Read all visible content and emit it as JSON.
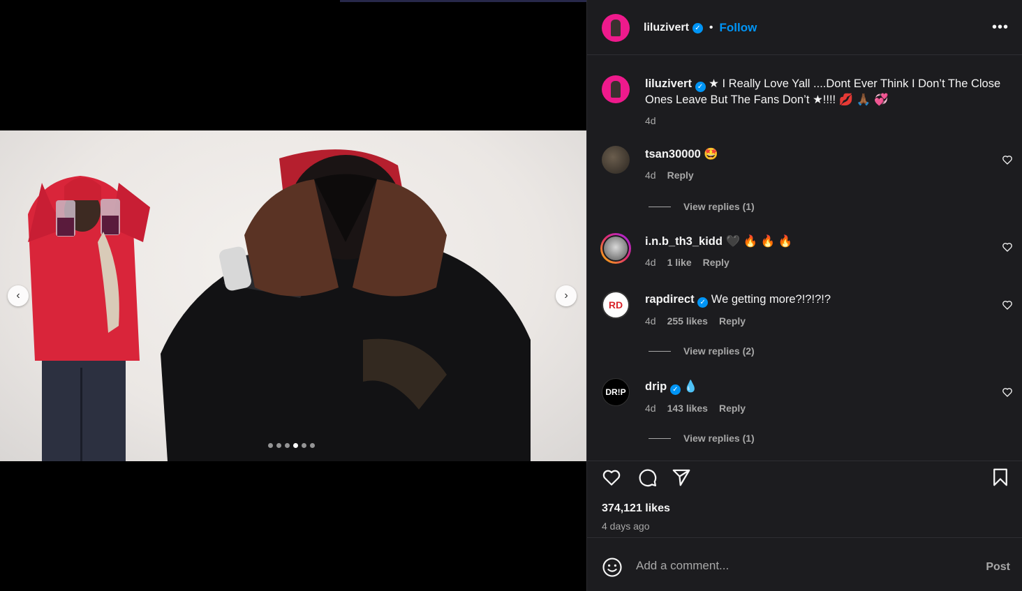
{
  "post": {
    "author": "liluzivert",
    "follow_label": "Follow",
    "separator": "•",
    "more_label": "•••"
  },
  "media": {
    "prev_label": "‹",
    "next_label": "›",
    "slide_count": 6,
    "active_slide": 4
  },
  "caption": {
    "username": "liluzivert",
    "text": "★ I Really Love Yall ....Dont Ever Think I Don’t The Close Ones Leave But The Fans Don’t ★!!!! 💋 🙏🏾 💞",
    "time": "4d"
  },
  "comments": [
    {
      "username": "tsan30000",
      "text": "🤩",
      "time": "4d",
      "likes": "",
      "reply_label": "Reply",
      "verified": false,
      "view_replies": "View replies (1)"
    },
    {
      "username": "i.n.b_th3_kidd",
      "text": "🖤 🔥 🔥 🔥",
      "time": "4d",
      "likes": "1 like",
      "reply_label": "Reply",
      "verified": false,
      "view_replies": ""
    },
    {
      "username": "rapdirect",
      "text": "We getting more?!?!?!?",
      "time": "4d",
      "likes": "255 likes",
      "reply_label": "Reply",
      "verified": true,
      "view_replies": "View replies (2)",
      "avatar_text": "RD"
    },
    {
      "username": "drip",
      "text": "💧",
      "time": "4d",
      "likes": "143 likes",
      "reply_label": "Reply",
      "verified": true,
      "view_replies": "View replies (1)",
      "avatar_text": "DR!P"
    }
  ],
  "stats": {
    "likes": "374,121 likes",
    "date": "4 days ago"
  },
  "composer": {
    "placeholder": "Add a comment...",
    "post_label": "Post"
  },
  "colors": {
    "panel_bg": "#1c1c1f",
    "link_blue": "#0095f6",
    "secondary_text": "#a8a8a8",
    "avatar_pink": "#ee1a8c"
  }
}
